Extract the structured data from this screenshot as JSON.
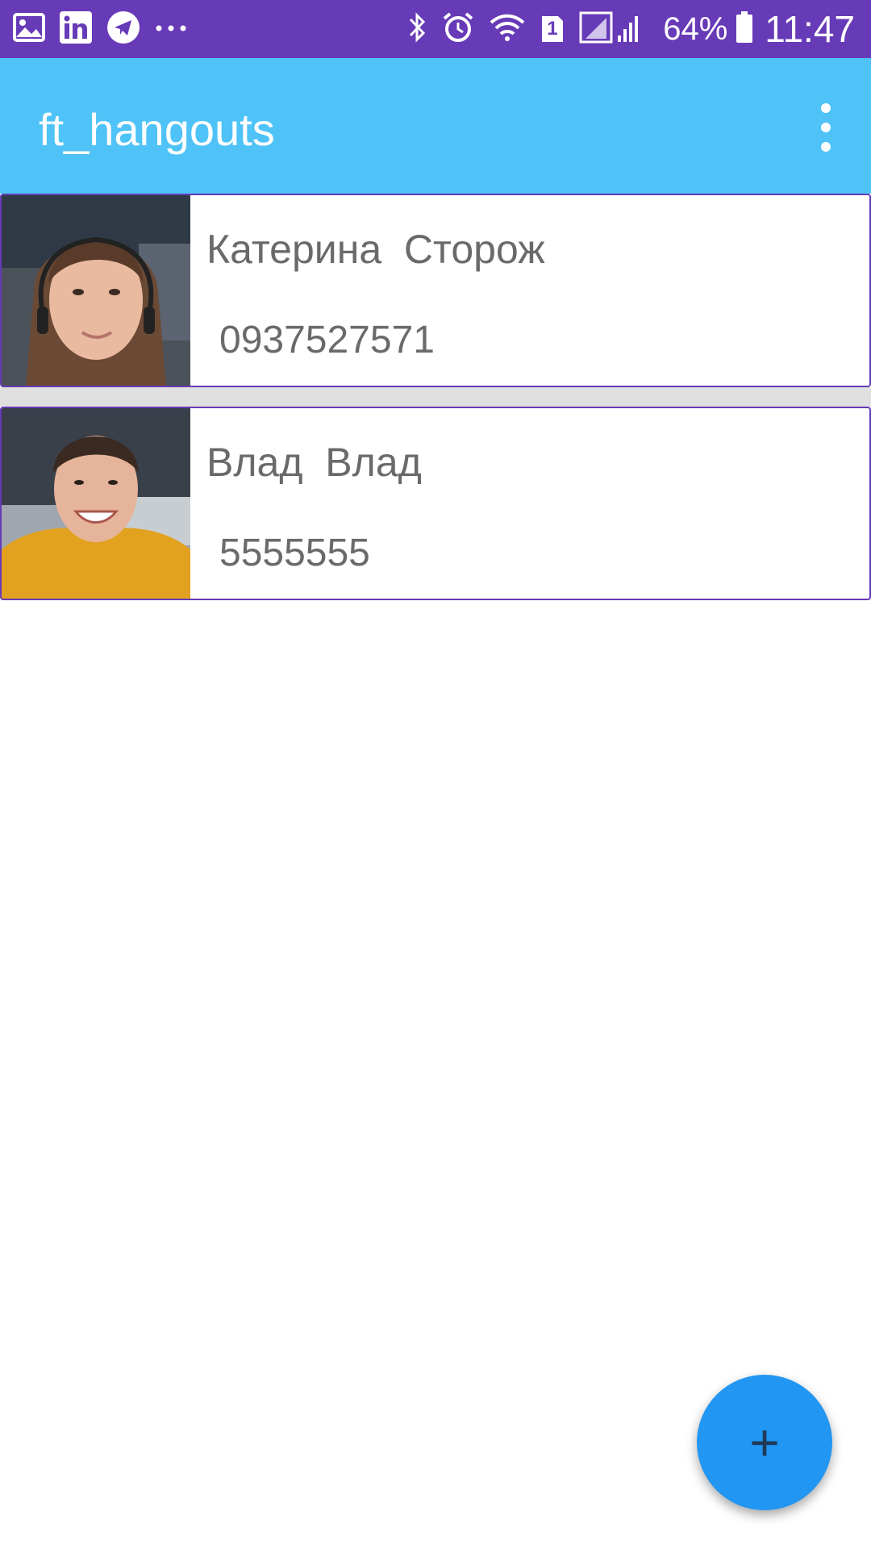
{
  "status_bar": {
    "battery_percent": "64%",
    "time": "11:47",
    "sim_slot": "1",
    "notification_icons": [
      "gallery-icon",
      "linkedin-icon",
      "telegram-icon",
      "more-notifications-icon"
    ],
    "system_icons": [
      "bluetooth-icon",
      "alarm-icon",
      "wifi-icon",
      "sim-icon",
      "signal-icon",
      "battery-icon"
    ],
    "color": "#673ab7"
  },
  "app_bar": {
    "title": "ft_hangouts",
    "color": "#4fc3f7",
    "overflow_icon": "overflow-menu-icon"
  },
  "contacts": [
    {
      "first_name": "Катерина",
      "last_name": "Сторож",
      "display_name": "Катерина  Сторож",
      "phone": "0937527571"
    },
    {
      "first_name": "Влад",
      "last_name": "Влад",
      "display_name": "Влад  Влад",
      "phone": "5555555"
    }
  ],
  "fab": {
    "label": "+",
    "icon": "add-icon",
    "color": "#2196f3"
  }
}
